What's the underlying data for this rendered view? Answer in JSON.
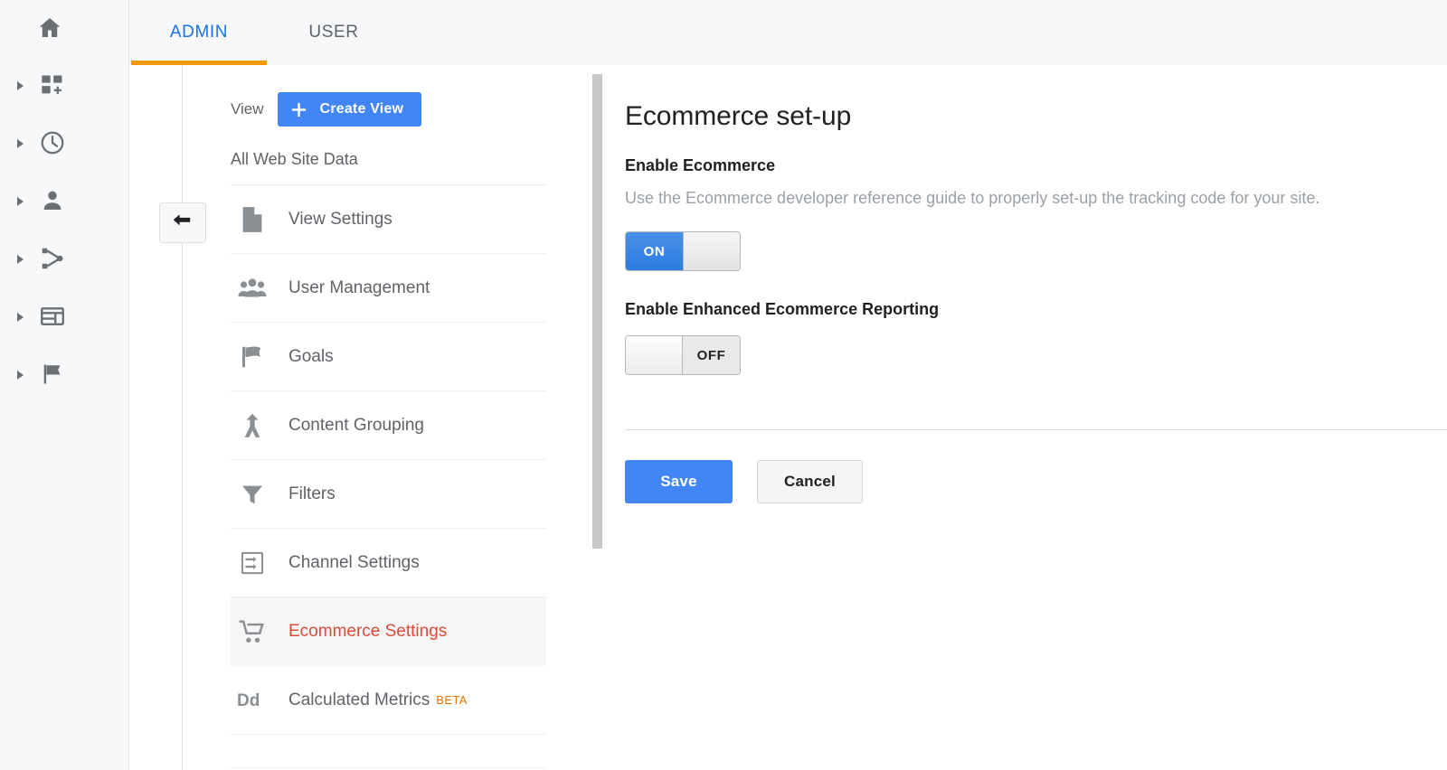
{
  "rail": {
    "home_icon": "home-icon",
    "items": [
      {
        "icon": "customization-icon",
        "name": "customization"
      },
      {
        "icon": "realtime-clock-icon",
        "name": "realtime"
      },
      {
        "icon": "audience-person-icon",
        "name": "audience"
      },
      {
        "icon": "acquisition-share-icon",
        "name": "acquisition"
      },
      {
        "icon": "behavior-layout-icon",
        "name": "behavior"
      },
      {
        "icon": "conversions-flag-icon",
        "name": "conversions"
      }
    ]
  },
  "tabs": [
    {
      "label": "ADMIN",
      "active": true
    },
    {
      "label": "USER",
      "active": false
    }
  ],
  "back_button": {
    "icon": "back-arrow-icon"
  },
  "view_panel": {
    "label": "View",
    "create_button": "Create View",
    "selected_view": "All Web Site Data"
  },
  "menu": {
    "items": [
      {
        "label": "View Settings",
        "icon": "document-icon",
        "active": false
      },
      {
        "label": "User Management",
        "icon": "people-icon",
        "active": false
      },
      {
        "label": "Goals",
        "icon": "flag-icon",
        "active": false
      },
      {
        "label": "Content Grouping",
        "icon": "content-grouping-icon",
        "active": false
      },
      {
        "label": "Filters",
        "icon": "funnel-icon",
        "active": false
      },
      {
        "label": "Channel Settings",
        "icon": "channel-settings-icon",
        "active": false
      },
      {
        "label": "Ecommerce Settings",
        "icon": "shopping-cart-icon",
        "active": true
      },
      {
        "label": "Calculated Metrics",
        "icon": "dd-icon",
        "badge": "BETA",
        "active": false
      }
    ]
  },
  "content": {
    "title": "Ecommerce set-up",
    "enable_ecommerce": {
      "label": "Enable Ecommerce",
      "description": "Use the Ecommerce developer reference guide to properly set-up the tracking code for your site.",
      "state": "ON"
    },
    "enhanced_ecommerce": {
      "label": "Enable Enhanced Ecommerce Reporting",
      "state": "OFF"
    },
    "save_label": "Save",
    "cancel_label": "Cancel"
  },
  "colors": {
    "accent_blue": "#4285f4",
    "tab_active_blue": "#1a73e8",
    "tab_underline_orange": "#f29900",
    "active_item_red": "#dd4b39",
    "beta_orange": "#e8710a",
    "icon_grey": "#757575"
  }
}
